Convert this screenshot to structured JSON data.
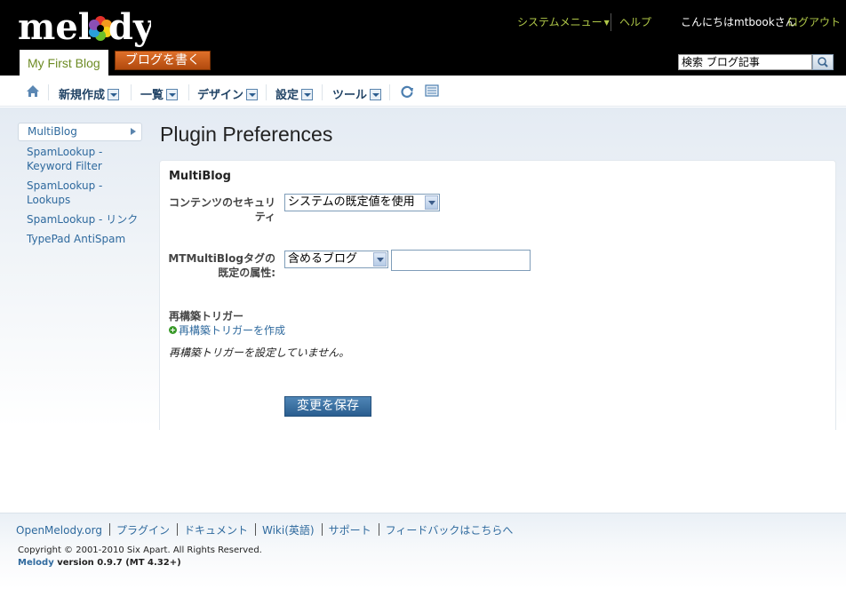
{
  "header": {
    "logo_text": "melody",
    "blog_name": "My First Blog",
    "write_button": "ブログを書く",
    "system_menu": "システムメニュー",
    "help": "ヘルプ",
    "greeting": "こんにちはmtbookさん",
    "logout": "ログアウト",
    "search_placeholder": "検索 ブログ記事"
  },
  "nav": {
    "new": "新規作成",
    "list": "一覧",
    "design": "デザイン",
    "settings": "設定",
    "tools": "ツール"
  },
  "sidebar": {
    "items": [
      {
        "label": "MultiBlog"
      },
      {
        "label": "SpamLookup - Keyword Filter"
      },
      {
        "label": "SpamLookup - Lookups"
      },
      {
        "label": "SpamLookup - リンク"
      },
      {
        "label": "TypePad AntiSpam"
      }
    ]
  },
  "main": {
    "title": "Plugin Preferences",
    "panel_title": "MultiBlog",
    "content_security_label": "コンテンツのセキュリティ",
    "content_security_value": "システムの既定値を使用",
    "tag_attr_label": "MTMultiBlogタグの既定の属性:",
    "tag_attr_value": "含めるブログ",
    "tag_attr_input": "",
    "trigger_heading": "再構築トリガー",
    "trigger_create": "再構築トリガーを作成",
    "trigger_none": "再構築トリガーを設定していません。",
    "save_button": "変更を保存"
  },
  "footer": {
    "links": [
      "OpenMelody.org",
      "プラグイン",
      "ドキュメント",
      "Wiki(英語)",
      "サポート",
      "フィードバックはこちらへ"
    ],
    "copyright": "Copyright © 2001-2010 Six Apart. All Rights Reserved.",
    "version_brand": "Melody",
    "version_text": " version 0.9.7 (MT 4.32+)"
  }
}
